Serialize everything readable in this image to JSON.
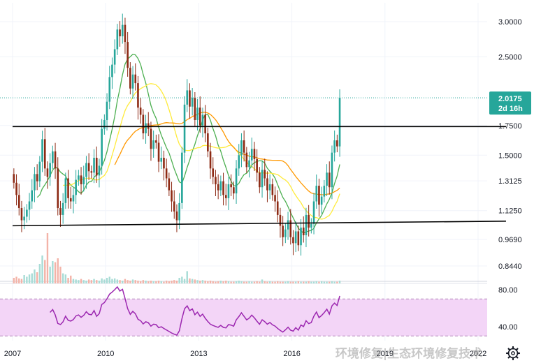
{
  "chart_data": {
    "type": "candlestick",
    "price_axis": {
      "scale": "log",
      "ticks": [
        "3.0000",
        "2.5000",
        "2.0175",
        "1.7500",
        "1.5000",
        "1.3125",
        "1.1250",
        "0.9690",
        "0.8440"
      ]
    },
    "x_axis": {
      "ticks": [
        "2007",
        "2010",
        "2013",
        "2016",
        "2019",
        "2022"
      ]
    },
    "last_price": {
      "value": "2.0175",
      "countdown": "2d 16h",
      "color": "#26a69a"
    },
    "colors": {
      "up": "#26a69a",
      "down": "#8d2a14",
      "ma_fast": "#4caf50",
      "ma_mid": "#ffeb3b",
      "ma_slow": "#ff9800",
      "rsi_line": "#9c27b0",
      "rsi_band": "#f3d5f7",
      "trendline": "#000000",
      "vol_up": "#a8dcd6",
      "vol_down": "#f3b3a8"
    },
    "candles_monthly": {
      "start_year": 2007.0,
      "close": [
        1.3,
        1.22,
        1.14,
        1.07,
        1.09,
        1.13,
        1.18,
        1.25,
        1.36,
        1.31,
        1.45,
        1.63,
        1.4,
        1.34,
        1.44,
        1.53,
        1.4,
        1.14,
        1.1,
        1.17,
        1.33,
        1.2,
        1.18,
        1.22,
        1.32,
        1.35,
        1.29,
        1.34,
        1.44,
        1.38,
        1.37,
        1.48,
        1.35,
        1.42,
        1.72,
        1.8,
        1.98,
        2.25,
        2.4,
        2.6,
        2.88,
        2.78,
        2.95,
        2.7,
        2.36,
        2.12,
        2.28,
        2.18,
        1.92,
        1.85,
        1.68,
        1.77,
        1.72,
        1.55,
        1.62,
        1.6,
        1.45,
        1.48,
        1.4,
        1.33,
        1.25,
        1.18,
        1.12,
        1.07,
        1.17,
        1.52,
        1.95,
        2.1,
        1.93,
        2.02,
        1.8,
        1.92,
        1.75,
        1.85,
        1.68,
        1.53,
        1.4,
        1.34,
        1.29,
        1.25,
        1.31,
        1.22,
        1.2,
        1.29,
        1.27,
        1.23,
        1.4,
        1.5,
        1.62,
        1.52,
        1.41,
        1.46,
        1.55,
        1.47,
        1.37,
        1.27,
        1.39,
        1.33,
        1.25,
        1.29,
        1.22,
        1.18,
        1.1,
        1.04,
        0.98,
        1.02,
        1.07,
        0.98,
        0.95,
        1.01,
        0.94,
        1.03,
        0.99,
        1.1,
        1.03,
        1.05,
        1.18,
        1.28,
        1.16,
        1.21,
        1.28,
        1.37,
        1.27,
        1.52,
        1.62,
        1.57,
        2.02
      ],
      "volume": [
        0.1,
        0.12,
        0.09,
        0.08,
        0.15,
        0.12,
        0.16,
        0.18,
        0.25,
        0.2,
        0.35,
        0.5,
        0.42,
        0.9,
        0.3,
        0.4,
        0.38,
        0.45,
        0.3,
        0.18,
        0.16,
        0.1,
        0.14,
        0.08,
        0.07,
        0.06,
        0.08,
        0.06,
        0.05,
        0.07,
        0.06,
        0.08,
        0.06,
        0.05,
        0.09,
        0.07,
        0.1,
        0.12,
        0.08,
        0.09,
        0.07,
        0.06,
        0.05,
        0.08,
        0.06,
        0.05,
        0.07,
        0.06,
        0.05,
        0.04,
        0.06,
        0.05,
        0.04,
        0.05,
        0.04,
        0.04,
        0.05,
        0.04,
        0.03,
        0.05,
        0.04,
        0.05,
        0.06,
        0.05,
        0.1,
        0.12,
        0.08,
        0.22,
        0.09,
        0.08,
        0.07,
        0.06,
        0.05,
        0.06,
        0.05,
        0.04,
        0.05,
        0.04,
        0.03,
        0.04,
        0.05,
        0.04,
        0.05,
        0.04,
        0.03,
        0.03,
        0.04,
        0.05,
        0.04,
        0.03,
        0.03,
        0.04,
        0.03,
        0.03,
        0.04,
        0.03,
        0.07,
        0.04,
        0.03,
        0.04,
        0.03,
        0.03,
        0.04,
        0.03,
        0.03,
        0.03,
        0.04,
        0.03,
        0.03,
        0.03,
        0.04,
        0.03,
        0.03,
        0.03,
        0.04,
        0.03,
        0.03,
        0.04,
        0.03,
        0.04,
        0.03,
        0.03,
        0.03,
        0.04,
        0.03,
        0.03,
        0.05
      ]
    },
    "trendlines": [
      {
        "from": [
          2007.0,
          1.74
        ],
        "to": [
          2022.9,
          1.74
        ]
      },
      {
        "from": [
          2007.0,
          1.04
        ],
        "to": [
          2022.9,
          1.065
        ]
      }
    ],
    "rsi_panel": {
      "ticks": [
        "80.00",
        "40.00"
      ],
      "band": [
        30,
        70
      ],
      "range": [
        25,
        85
      ]
    },
    "watermark": "环境修复|生态环境修复技术"
  }
}
